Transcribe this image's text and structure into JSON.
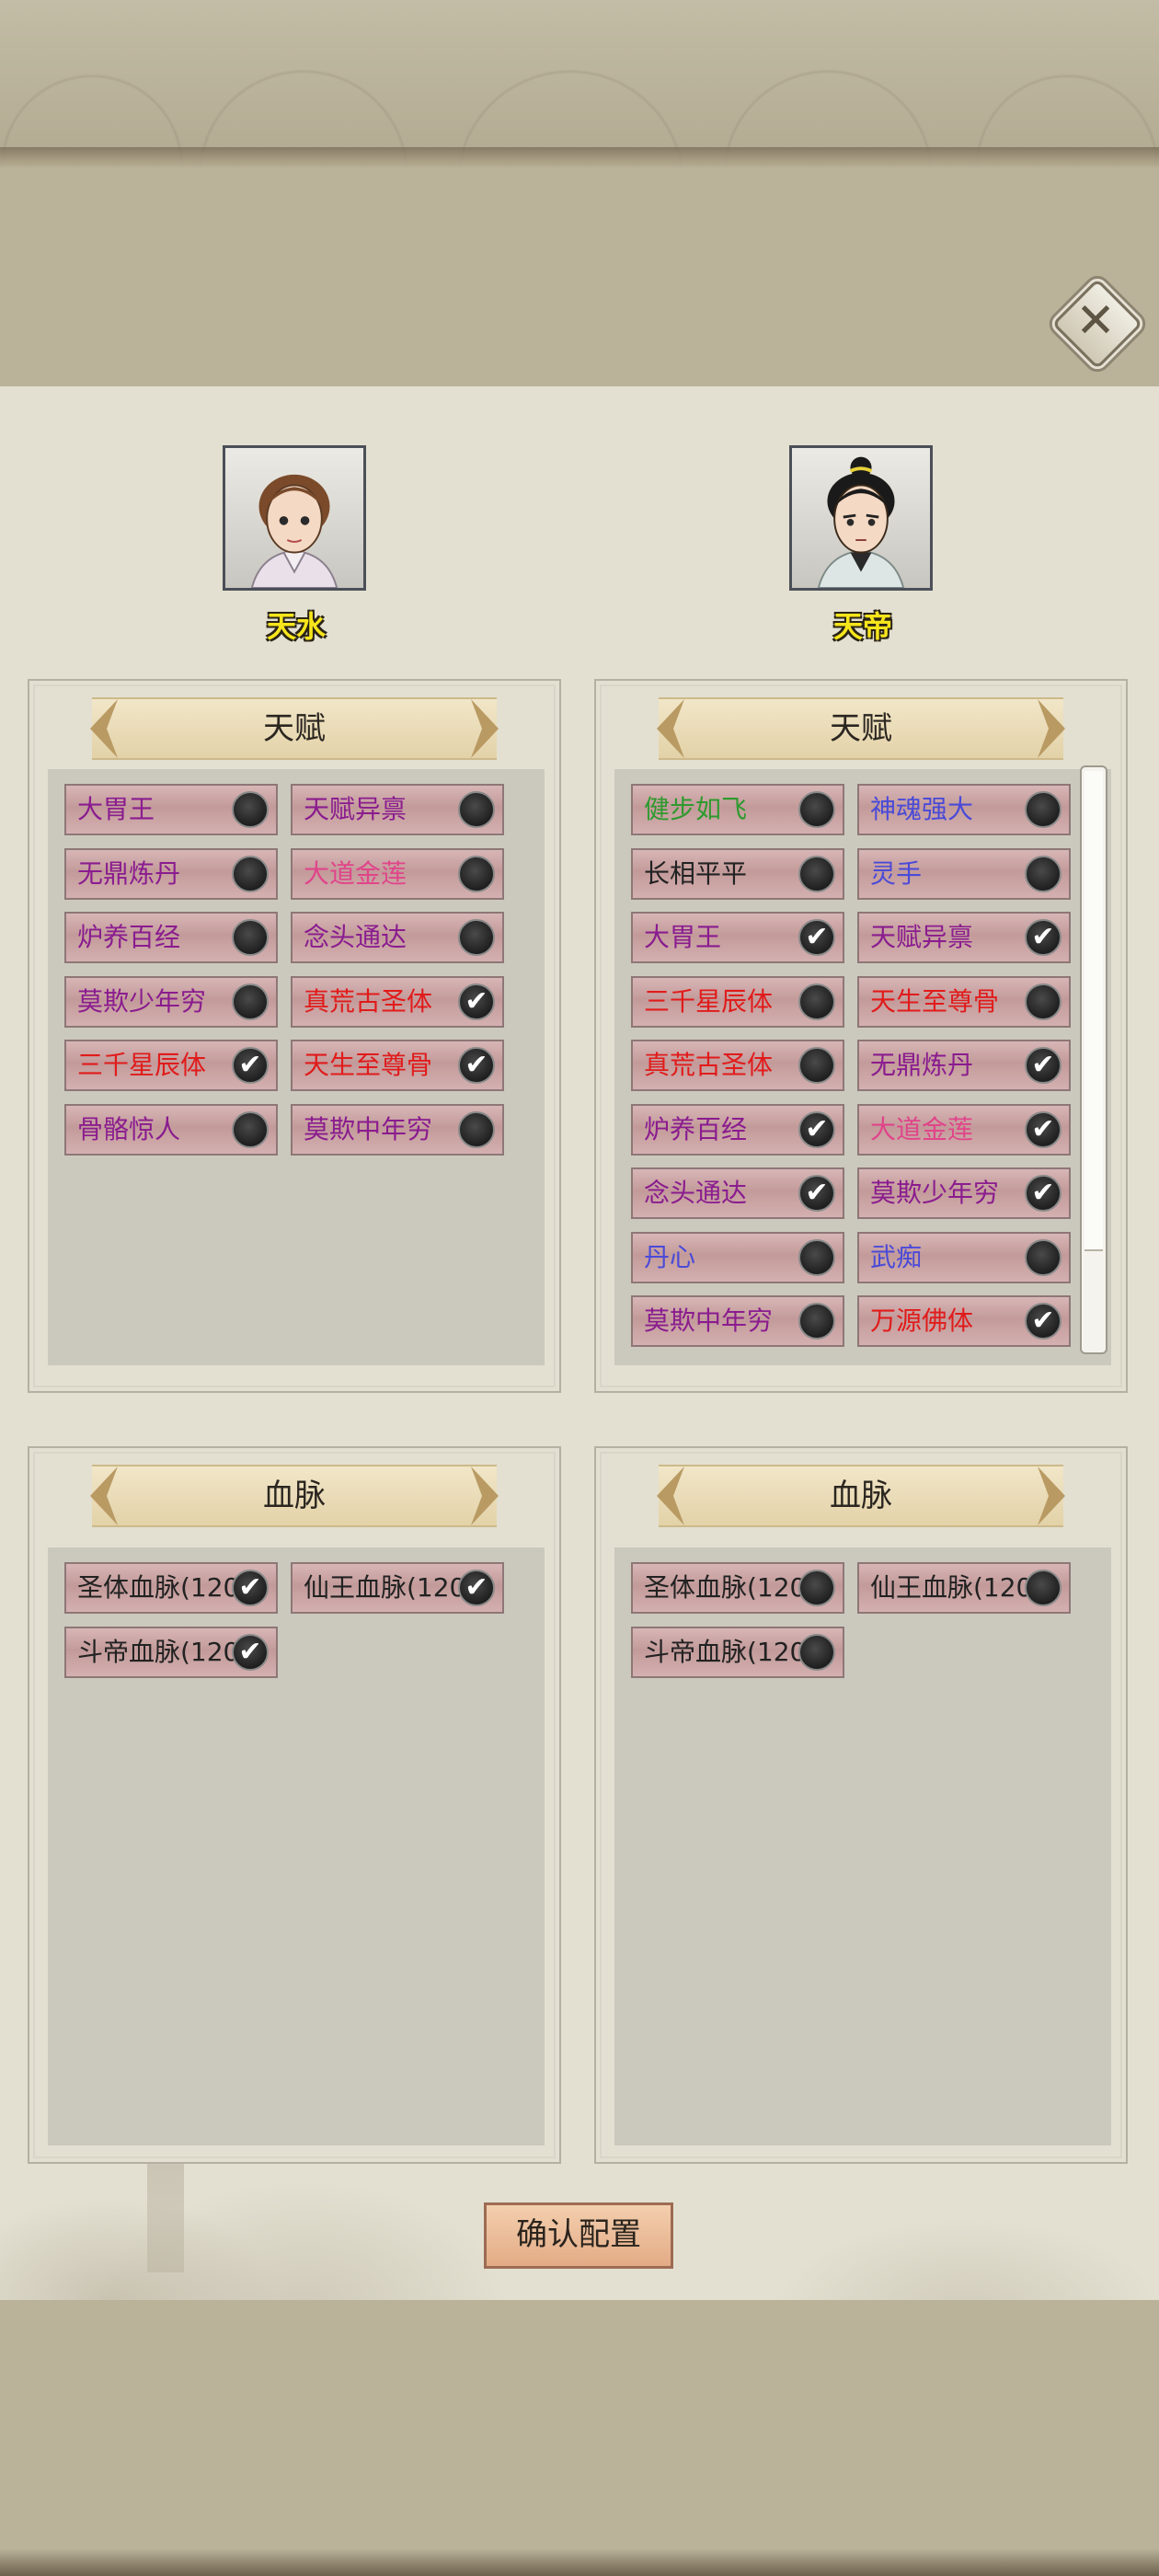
{
  "colors": {
    "purple": "#8a1c8f",
    "pink": "#e0458a",
    "red": "#e11b1b",
    "green": "#2f9a2f",
    "blue": "#4a4ad8",
    "black": "#222222",
    "name_yellow": "#f7e51c"
  },
  "left_character": {
    "name": "天水",
    "talent_title": "天赋",
    "talents": [
      {
        "label": "大胃王",
        "color": "purple",
        "checked": false
      },
      {
        "label": "天赋异禀",
        "color": "purple",
        "checked": false
      },
      {
        "label": "无鼎炼丹",
        "color": "purple",
        "checked": false
      },
      {
        "label": "大道金莲",
        "color": "pink",
        "checked": false
      },
      {
        "label": "炉养百经",
        "color": "purple",
        "checked": false
      },
      {
        "label": "念头通达",
        "color": "purple",
        "checked": false
      },
      {
        "label": "莫欺少年穷",
        "color": "purple",
        "checked": false
      },
      {
        "label": "真荒古圣体",
        "color": "red",
        "checked": true
      },
      {
        "label": "三千星辰体",
        "color": "red",
        "checked": true
      },
      {
        "label": "天生至尊骨",
        "color": "red",
        "checked": true
      },
      {
        "label": "骨骼惊人",
        "color": "purple",
        "checked": false
      },
      {
        "label": "莫欺中年穷",
        "color": "purple",
        "checked": false
      }
    ],
    "bloodline_title": "血脉",
    "bloodlines": [
      {
        "label": "圣体血脉(120)",
        "color": "black",
        "checked": true
      },
      {
        "label": "仙王血脉(120)",
        "color": "black",
        "checked": true
      },
      {
        "label": "斗帝血脉(120)",
        "color": "black",
        "checked": true
      }
    ]
  },
  "right_character": {
    "name": "天帝",
    "talent_title": "天赋",
    "talents": [
      {
        "label": "健步如飞",
        "color": "green",
        "checked": false
      },
      {
        "label": "神魂强大",
        "color": "blue",
        "checked": false
      },
      {
        "label": "长相平平",
        "color": "black",
        "checked": false
      },
      {
        "label": "灵手",
        "color": "blue",
        "checked": false
      },
      {
        "label": "大胃王",
        "color": "purple",
        "checked": true
      },
      {
        "label": "天赋异禀",
        "color": "purple",
        "checked": true
      },
      {
        "label": "三千星辰体",
        "color": "red",
        "checked": false
      },
      {
        "label": "天生至尊骨",
        "color": "red",
        "checked": false
      },
      {
        "label": "真荒古圣体",
        "color": "red",
        "checked": false
      },
      {
        "label": "无鼎炼丹",
        "color": "purple",
        "checked": true
      },
      {
        "label": "炉养百经",
        "color": "purple",
        "checked": true
      },
      {
        "label": "大道金莲",
        "color": "pink",
        "checked": true
      },
      {
        "label": "念头通达",
        "color": "purple",
        "checked": true
      },
      {
        "label": "莫欺少年穷",
        "color": "purple",
        "checked": true
      },
      {
        "label": "丹心",
        "color": "blue",
        "checked": false
      },
      {
        "label": "武痴",
        "color": "blue",
        "checked": false
      },
      {
        "label": "莫欺中年穷",
        "color": "purple",
        "checked": false
      },
      {
        "label": "万源佛体",
        "color": "red",
        "checked": true
      }
    ],
    "bloodline_title": "血脉",
    "bloodlines": [
      {
        "label": "圣体血脉(120)",
        "color": "black",
        "checked": false
      },
      {
        "label": "仙王血脉(120)",
        "color": "black",
        "checked": false
      },
      {
        "label": "斗帝血脉(120)",
        "color": "black",
        "checked": false
      }
    ]
  },
  "icons": {
    "close": "close-icon",
    "checked": "checkmark-icon",
    "unchecked": "circle-icon"
  },
  "confirm_label": "确认配置"
}
